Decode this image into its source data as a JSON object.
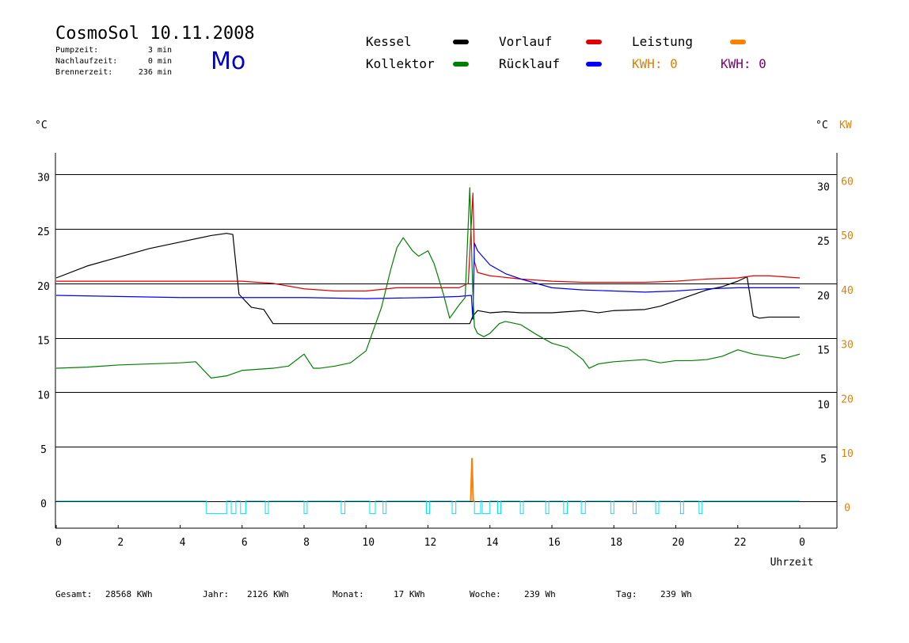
{
  "header": {
    "title": "CosmoSol 10.11.2008",
    "weekday": "Mo",
    "stats": [
      {
        "label": "Pumpzeit:",
        "value": "3 min"
      },
      {
        "label": "Nachlaufzeit:",
        "value": "0 min"
      },
      {
        "label": "Brennerzeit:",
        "value": "236 min"
      }
    ]
  },
  "legend": {
    "items": [
      {
        "label": "Kessel",
        "color": "#000000"
      },
      {
        "label": "Vorlauf",
        "color": "#e00000"
      },
      {
        "label": "Leistung",
        "color": "#ff8000"
      },
      {
        "label": "Kollektor",
        "color": "#008000"
      },
      {
        "label": "Rücklauf",
        "color": "#0000ff"
      }
    ],
    "kwh": [
      {
        "label": "KWH: 0",
        "color": "#e08000"
      },
      {
        "label": "KWH: 0",
        "color": "#800080"
      }
    ]
  },
  "axes": {
    "left_unit": "°C",
    "right_unit": "°C",
    "right_unit2": "KW",
    "xlabel": "Uhrzeit"
  },
  "footer": [
    {
      "label": "Gesamt:",
      "value": "28568 KWh"
    },
    {
      "label": "Jahr:",
      "value": "2126 KWh"
    },
    {
      "label": "Monat:",
      "value": "17 KWh"
    },
    {
      "label": "Woche:",
      "value": "239 Wh"
    },
    {
      "label": "Tag:",
      "value": "239 Wh"
    }
  ],
  "chart_data": {
    "type": "line",
    "xlim": [
      0,
      24
    ],
    "ylim": [
      -2.5,
      32
    ],
    "y2lim": [
      -5,
      64
    ],
    "x_ticks": [
      "0",
      "2",
      "4",
      "6",
      "8",
      "10",
      "12",
      "14",
      "16",
      "18",
      "20",
      "22",
      "0"
    ],
    "y_ticks_left": [
      "0",
      "5",
      "10",
      "15",
      "20",
      "25",
      "30"
    ],
    "y_ticks_right": [
      "5",
      "10",
      "15",
      "20",
      "25",
      "30"
    ],
    "y2_ticks": [
      "0",
      "10",
      "20",
      "30",
      "40",
      "50",
      "60"
    ],
    "grid": "horizontal",
    "series": [
      {
        "name": "Kessel",
        "color": "#000000",
        "x": [
          0,
          1,
          2,
          3,
          4,
          5,
          5.5,
          5.7,
          5.9,
          6.3,
          6.7,
          7,
          8,
          10,
          11,
          12,
          13,
          13.35,
          13.45,
          13.6,
          14,
          14.5,
          15,
          16,
          17,
          17.5,
          18,
          19,
          19.5,
          20,
          20.5,
          21,
          21.5,
          22,
          22.3,
          22.5,
          22.7,
          23,
          24
        ],
        "y": [
          20.5,
          21.6,
          22.4,
          23.2,
          23.8,
          24.4,
          24.6,
          24.5,
          19,
          17.8,
          17.6,
          16.3,
          16.3,
          16.3,
          16.3,
          16.3,
          16.3,
          16.3,
          17,
          17.5,
          17.3,
          17.4,
          17.3,
          17.3,
          17.5,
          17.3,
          17.5,
          17.6,
          17.9,
          18.4,
          18.9,
          19.4,
          19.7,
          20.2,
          20.6,
          17,
          16.8,
          16.9,
          16.9
        ]
      },
      {
        "name": "Vorlauf",
        "color": "#e00000",
        "x": [
          0,
          2,
          4,
          6,
          7,
          8,
          9,
          10,
          11,
          12,
          13,
          13.3,
          13.45,
          13.5,
          13.6,
          14,
          15,
          16,
          17,
          18,
          19,
          20,
          21,
          22,
          22.5,
          23,
          24
        ],
        "y": [
          20.2,
          20.2,
          20.2,
          20.2,
          20.0,
          19.5,
          19.3,
          19.3,
          19.6,
          19.6,
          19.6,
          20.0,
          28.3,
          22,
          21.0,
          20.7,
          20.4,
          20.2,
          20.1,
          20.1,
          20.1,
          20.2,
          20.4,
          20.5,
          20.7,
          20.7,
          20.5
        ]
      },
      {
        "name": "Rücklauf",
        "color": "#0000ff",
        "x": [
          0,
          2,
          4,
          6,
          8,
          10,
          12,
          13,
          13.4,
          13.45,
          13.5,
          13.6,
          14,
          14.5,
          15,
          16,
          17,
          18,
          19,
          20,
          21,
          22,
          24
        ],
        "y": [
          18.9,
          18.8,
          18.7,
          18.7,
          18.7,
          18.6,
          18.7,
          18.8,
          18.9,
          16.7,
          23.7,
          23.0,
          21.7,
          20.9,
          20.4,
          19.6,
          19.4,
          19.3,
          19.2,
          19.3,
          19.5,
          19.6,
          19.6
        ]
      },
      {
        "name": "Kollektor",
        "color": "#008000",
        "x": [
          0,
          1,
          2,
          3,
          4,
          4.5,
          5,
          5.5,
          6,
          6.5,
          7,
          7.5,
          8,
          8.3,
          8.5,
          9,
          9.5,
          10,
          10.5,
          10.8,
          11,
          11.2,
          11.5,
          11.7,
          12,
          12.2,
          12.5,
          12.7,
          13,
          13.2,
          13.35,
          13.45,
          13.5,
          13.6,
          13.8,
          14,
          14.3,
          14.5,
          15,
          15.5,
          16,
          16.5,
          17,
          17.2,
          17.5,
          18,
          18.5,
          19,
          19.5,
          20,
          20.5,
          21,
          21.5,
          22,
          22.5,
          23,
          23.5,
          24
        ],
        "y": [
          12.2,
          12.3,
          12.5,
          12.6,
          12.7,
          12.8,
          11.3,
          11.5,
          12.0,
          12.1,
          12.2,
          12.4,
          13.5,
          12.2,
          12.2,
          12.4,
          12.7,
          13.8,
          17.8,
          21.3,
          23.3,
          24.2,
          23.0,
          22.5,
          23.0,
          21.8,
          19,
          16.8,
          18.0,
          18.7,
          28.8,
          19,
          16,
          15.4,
          15.1,
          15.4,
          16.3,
          16.5,
          16.2,
          15.3,
          14.5,
          14.1,
          13.0,
          12.2,
          12.6,
          12.8,
          12.9,
          13.0,
          12.7,
          12.9,
          12.9,
          13.0,
          13.3,
          13.9,
          13.5,
          13.3,
          13.1,
          13.5
        ]
      },
      {
        "name": "Leistung",
        "color": "#ff8000",
        "x": [
          13.38,
          13.42,
          13.46,
          13.5
        ],
        "y2": [
          0,
          7.8,
          0,
          0
        ]
      }
    ],
    "pump_pulses_hours": [
      [
        4.85,
        5.5
      ],
      [
        5.65,
        5.8
      ],
      [
        5.95,
        6.12
      ],
      [
        6.75,
        6.85
      ],
      [
        8.0,
        8.1
      ],
      [
        9.2,
        9.32
      ],
      [
        10.12,
        10.3
      ],
      [
        10.55,
        10.65
      ],
      [
        11.95,
        12.05
      ],
      [
        12.78,
        12.9
      ],
      [
        13.5,
        13.7
      ],
      [
        13.75,
        14.0
      ],
      [
        14.25,
        14.35
      ],
      [
        14.98,
        15.08
      ],
      [
        15.8,
        15.9
      ],
      [
        16.38,
        16.5
      ],
      [
        16.95,
        17.08
      ],
      [
        17.9,
        18.0
      ],
      [
        18.62,
        18.72
      ],
      [
        19.35,
        19.45
      ],
      [
        20.15,
        20.25
      ],
      [
        20.75,
        20.85
      ]
    ],
    "pump_color": "#00e0ff"
  }
}
